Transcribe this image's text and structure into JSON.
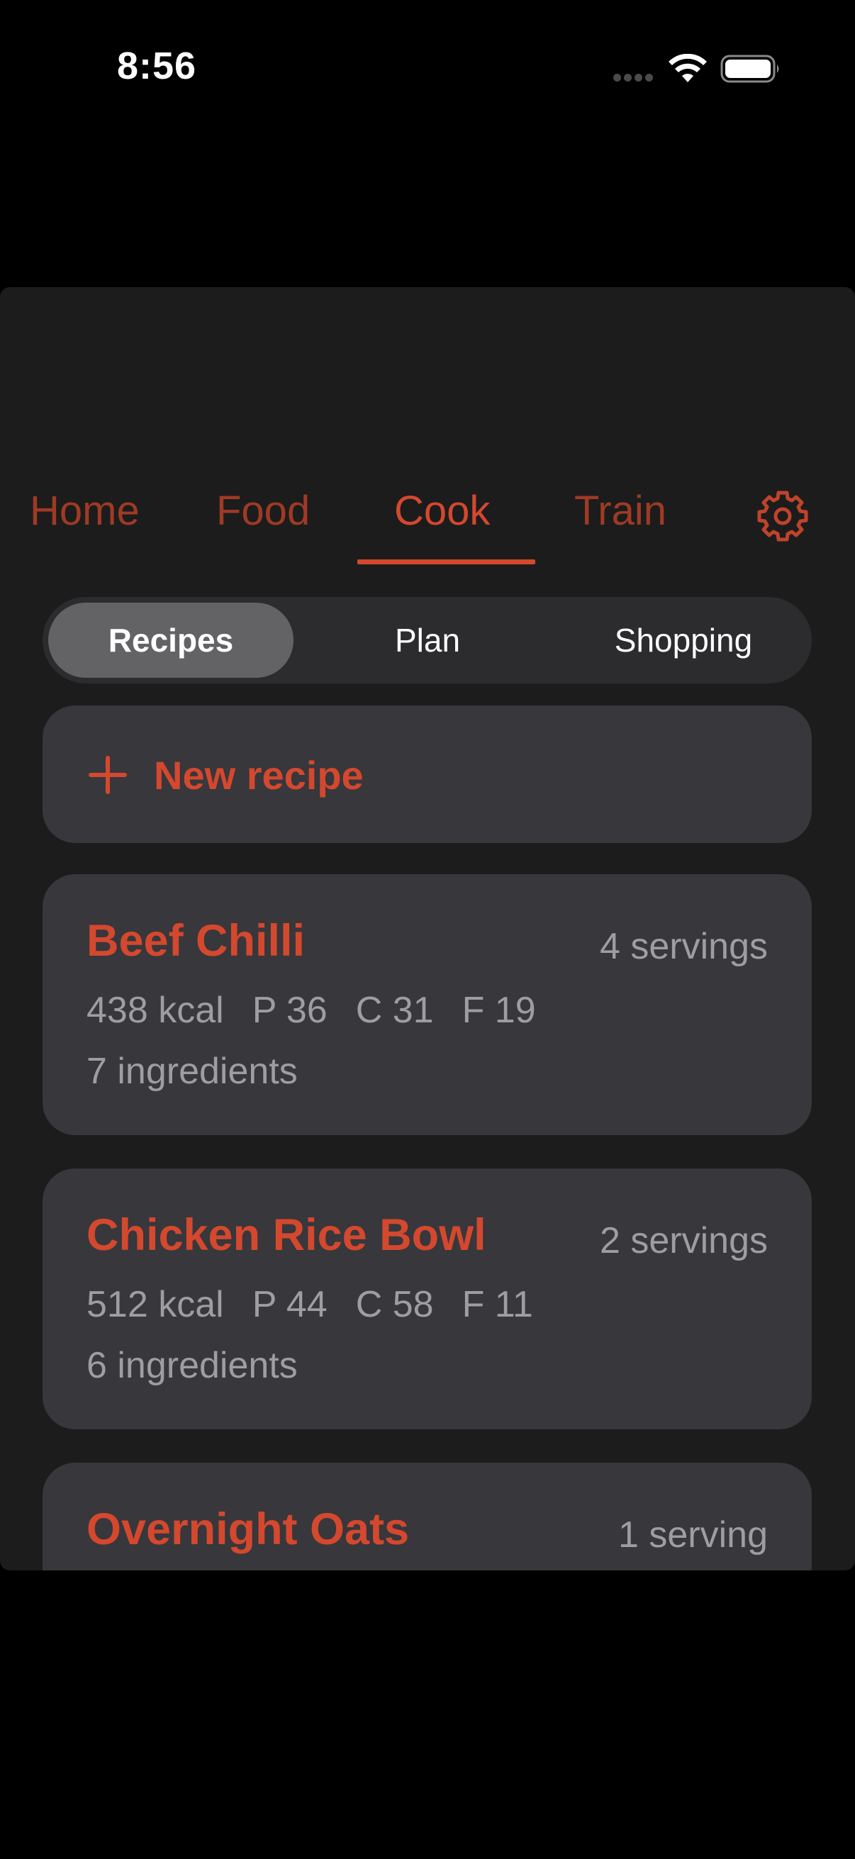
{
  "status_bar": {
    "time": "8:56"
  },
  "nav": {
    "tabs": [
      {
        "label": "Home",
        "active": false
      },
      {
        "label": "Food",
        "active": false
      },
      {
        "label": "Cook",
        "active": true
      },
      {
        "label": "Train",
        "active": false
      }
    ],
    "settings_icon": "gear-icon"
  },
  "segments": {
    "items": [
      "Recipes",
      "Plan",
      "Shopping"
    ],
    "selected": "Recipes"
  },
  "new_recipe": {
    "icon": "plus-icon",
    "label": "New recipe"
  },
  "recipes": [
    {
      "name": "Beef Chilli",
      "servings": "4 servings",
      "kcal": "438 kcal",
      "protein": "P 36",
      "carbs": "C 31",
      "fat": "F 19",
      "ingredients": "7 ingredients"
    },
    {
      "name": "Chicken Rice Bowl",
      "servings": "2 servings",
      "kcal": "512 kcal",
      "protein": "P 44",
      "carbs": "C 58",
      "fat": "F 11",
      "ingredients": "6 ingredients"
    },
    {
      "name": "Overnight Oats",
      "servings": "1 serving"
    }
  ],
  "colors": {
    "accent": "#d4482e",
    "tab_inactive": "#9f3a25",
    "card_bg": "#37373c",
    "sheet_bg": "#1c1c1c"
  }
}
